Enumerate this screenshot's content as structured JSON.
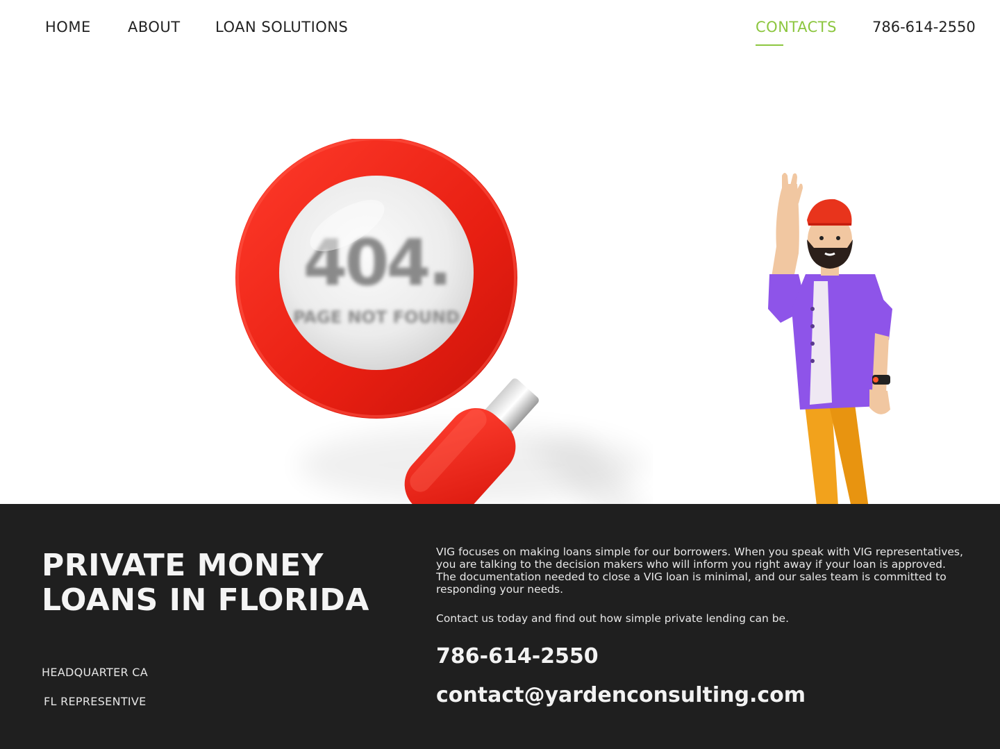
{
  "nav": {
    "home": "HOME",
    "about": "ABOUT",
    "loan_solutions": "LOAN SOLUTIONS",
    "contacts": "CONTACTS",
    "phone": "786-614-2550",
    "active_color": "#8cc63f"
  },
  "hero": {
    "error_code": "404.",
    "error_message": "PAGE NOT FOUND"
  },
  "footer": {
    "title_line1": "PRIVATE MONEY",
    "title_line2": "LOANS IN FLORIDA",
    "location_1": "HEADQUARTER CA",
    "location_2": "FL REPRESENTIVE",
    "description": "VIG focuses on making loans simple for our borrowers. When you speak with VIG representatives, you are talking to the decision makers who will inform you right away if your loan is approved. The documentation needed to close a VIG loan is minimal, and our sales team is committed to responding your needs.",
    "cta": "Contact us today and find out how simple private lending can be.",
    "phone": "786-614-2550",
    "email": "contact@yardenconsulting.com",
    "background_color": "#1f1f1f"
  }
}
